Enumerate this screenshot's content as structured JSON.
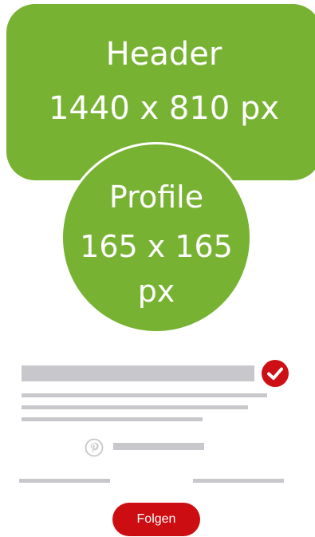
{
  "header": {
    "line1": "Header",
    "line2": "1440 x 810 px"
  },
  "profile": {
    "line1": "Profile",
    "line2": "165 x 165",
    "line3": "px"
  },
  "icons": {
    "verified": "check-circle-icon",
    "pinterest": "pinterest-icon"
  },
  "colors": {
    "accent_green": "#78b233",
    "brand_red": "#cc0e12",
    "placeholder_gray": "#c8c8cc"
  },
  "follow_button": {
    "label": "Folgen"
  }
}
